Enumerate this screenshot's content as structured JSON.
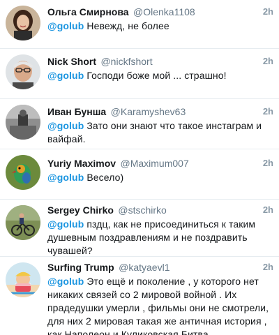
{
  "tweets": [
    {
      "name": "Ольга Смирнова",
      "handle": "@Olenka1108",
      "time": "2h",
      "mention": "@golub",
      "text": "Невежд, не более",
      "avatar_icon": "woman-portrait-avatar"
    },
    {
      "name": "Nick Short",
      "handle": "@nickfshort",
      "time": "2h",
      "mention": "@golub",
      "text": "Господи боже мой ... страшно!",
      "avatar_icon": "man-glasses-avatar"
    },
    {
      "name": "Иван Бунша",
      "handle": "@Karamyshev63",
      "time": "2h",
      "mention": "@golub",
      "text": "Зато они знают что такое инстаграм и вайфай.",
      "avatar_icon": "bw-photo-avatar"
    },
    {
      "name": "Yuriy Maximov",
      "handle": "@Maximum007",
      "time": "2h",
      "mention": "@golub",
      "text": "Весело)",
      "avatar_icon": "parrot-avatar"
    },
    {
      "name": "Sergey Chirko",
      "handle": "@stschirko",
      "time": "2h",
      "mention": "@golub",
      "text": "пздц, как не присоединиться к таким душевным поздравлениям и не поздравить чувашей?",
      "avatar_icon": "cyclist-avatar"
    },
    {
      "name": "Surfing Trump",
      "handle": "@katyaevl1",
      "time": "2h",
      "mention": "@golub",
      "text": "Это ещё и поколение , у которого нет никаких связей со 2 мировой войной . Их прадедушки умерли , фильмы они не смотрели, для них 2 мировая такая же античная история , как Наполеон и Куликовская Битва .",
      "avatar_icon": "cartoon-trump-avatar"
    }
  ]
}
